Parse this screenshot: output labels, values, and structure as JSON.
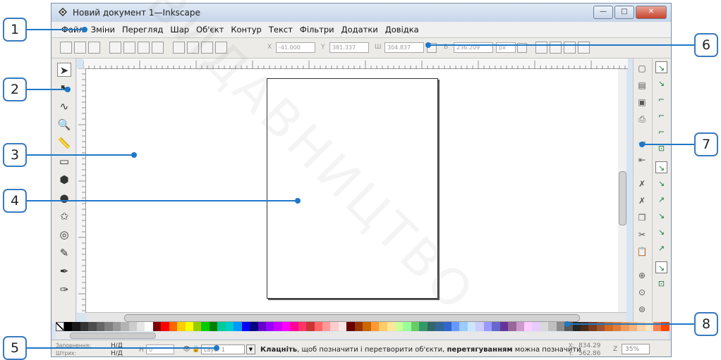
{
  "window": {
    "title": "Новий документ 1—Inkscape",
    "buttons": {
      "minimize": "—",
      "maximize": "□",
      "close": "✕"
    }
  },
  "menubar": [
    "Файл",
    "Зміни",
    "Перегляд",
    "Шар",
    "Об'єкт",
    "Контур",
    "Текст",
    "Фільтри",
    "Додатки",
    "Довідка"
  ],
  "toolbar": {
    "x_label": "X",
    "x_value": "-41.000",
    "y_label": "Y",
    "y_value": "381.337",
    "w_label": "Ш",
    "w_value": "304.837",
    "h_label": "В",
    "h_value": "236.209",
    "unit": "px"
  },
  "tools": [
    {
      "name": "selector-tool-icon",
      "glyph": "➤"
    },
    {
      "name": "node-tool-icon",
      "glyph": "⬉"
    },
    {
      "name": "tweak-tool-icon",
      "glyph": "∿"
    },
    {
      "name": "zoom-tool-icon",
      "glyph": "🔍"
    },
    {
      "name": "measure-tool-icon",
      "glyph": "📏"
    },
    {
      "name": "rectangle-tool-icon",
      "glyph": "▭"
    },
    {
      "name": "3d-box-tool-icon",
      "glyph": "⬢"
    },
    {
      "name": "ellipse-tool-icon",
      "glyph": "●"
    },
    {
      "name": "star-tool-icon",
      "glyph": "✩"
    },
    {
      "name": "spiral-tool-icon",
      "glyph": "◎"
    },
    {
      "name": "pencil-tool-icon",
      "glyph": "✎"
    },
    {
      "name": "pen-tool-icon",
      "glyph": "✒"
    },
    {
      "name": "calligraphy-tool-icon",
      "glyph": "✑"
    }
  ],
  "commands": [
    {
      "name": "new-document-icon",
      "glyph": "▢"
    },
    {
      "name": "open-document-icon",
      "glyph": "▤"
    },
    {
      "name": "save-document-icon",
      "glyph": "▣"
    },
    {
      "name": "print-icon",
      "glyph": "⎙"
    },
    {
      "name": "import-icon",
      "glyph": "⇥"
    },
    {
      "name": "export-icon",
      "glyph": "⇤"
    },
    {
      "name": "undo-icon",
      "glyph": "✗"
    },
    {
      "name": "redo-icon",
      "glyph": "✗"
    },
    {
      "name": "copy-icon",
      "glyph": "❐"
    },
    {
      "name": "cut-icon",
      "glyph": "✂"
    },
    {
      "name": "paste-icon",
      "glyph": "📋"
    },
    {
      "name": "zoom-selection-icon",
      "glyph": "⊕"
    },
    {
      "name": "zoom-drawing-icon",
      "glyph": "⊙"
    },
    {
      "name": "zoom-page-icon",
      "glyph": "⊚"
    }
  ],
  "snaps": [
    {
      "name": "snap-toggle-icon",
      "glyph": "↘",
      "on": true
    },
    {
      "name": "snap-bbox-icon",
      "glyph": "↘",
      "on": false
    },
    {
      "name": "snap-bbox-edge-icon",
      "glyph": "⌐",
      "on": false
    },
    {
      "name": "snap-bbox-corner-icon",
      "glyph": "⌐",
      "on": false
    },
    {
      "name": "snap-bbox-midpoint-icon",
      "glyph": "⌐",
      "on": false
    },
    {
      "name": "snap-bbox-center-icon",
      "glyph": "⊡",
      "on": false
    },
    {
      "name": "snap-nodes-icon",
      "glyph": "↘",
      "on": true
    },
    {
      "name": "snap-path-icon",
      "glyph": "↘",
      "on": false
    },
    {
      "name": "snap-intersection-icon",
      "glyph": "↗",
      "on": false
    },
    {
      "name": "snap-cusp-icon",
      "glyph": "↘",
      "on": false
    },
    {
      "name": "snap-smooth-icon",
      "glyph": "↘",
      "on": false
    },
    {
      "name": "snap-midpoint-icon",
      "glyph": "↗",
      "on": false
    },
    {
      "name": "snap-others-icon",
      "glyph": "↘",
      "on": true
    },
    {
      "name": "snap-center-icon",
      "glyph": "⊡",
      "on": false
    }
  ],
  "palette": [
    "#000000",
    "#1a1a1a",
    "#333333",
    "#4d4d4d",
    "#666666",
    "#808080",
    "#999999",
    "#b3b3b3",
    "#cccccc",
    "#e6e6e6",
    "#ffffff",
    "#800000",
    "#ff0000",
    "#ff6600",
    "#ffcc00",
    "#ffff00",
    "#99cc00",
    "#00cc00",
    "#008000",
    "#00cc99",
    "#00cccc",
    "#0099ff",
    "#0000ff",
    "#000080",
    "#6600cc",
    "#9900ff",
    "#cc00ff",
    "#ff00ff",
    "#ff0099",
    "#ff3366",
    "#cc3333",
    "#ff6666",
    "#ff9999",
    "#ffcccc",
    "#ffe6e6",
    "#660000",
    "#993300",
    "#cc6600",
    "#ff9933",
    "#ffcc66",
    "#ffe699",
    "#ccff99",
    "#99ff99",
    "#66cc66",
    "#339966",
    "#336666",
    "#336699",
    "#3366cc",
    "#6699ff",
    "#99ccff",
    "#cce6ff",
    "#ccccff",
    "#9999ff",
    "#6666cc",
    "#663399",
    "#996699",
    "#cc99cc",
    "#ffccff",
    "#e6ccff",
    "#d9d9d9",
    "#bfbfbf",
    "#8c8c8c",
    "#595959",
    "#262626",
    "#4b2a1a",
    "#7a3b1e",
    "#a0522d",
    "#d2691e",
    "#e07b39",
    "#f09a5a",
    "#f5b27d",
    "#ffd1a8",
    "#ffe4c4",
    "#ff7f50",
    "#ff4500"
  ],
  "status": {
    "fill_label": "Заповнення:",
    "stroke_label": "Штрих:",
    "fill_value": "Н/Д",
    "stroke_value": "Н/Д",
    "opacity_label": "Н",
    "opacity_value": "0",
    "layer": "Layer 1",
    "message_bold1": "Клацніть",
    "message_rest1": ", щоб позначити і перетворити об'єкти, ",
    "message_bold2": "перетягуванням",
    "message_rest2": " можна позначити",
    "x_label": "X:",
    "x_value": "834.29",
    "y_label": "Y:",
    "y_value": "562.86",
    "z_label": "Z",
    "zoom": "35%"
  },
  "callouts": [
    "1",
    "2",
    "3",
    "4",
    "5",
    "6",
    "7",
    "8"
  ],
  "watermark": "ВИДАВНИЦТВО"
}
